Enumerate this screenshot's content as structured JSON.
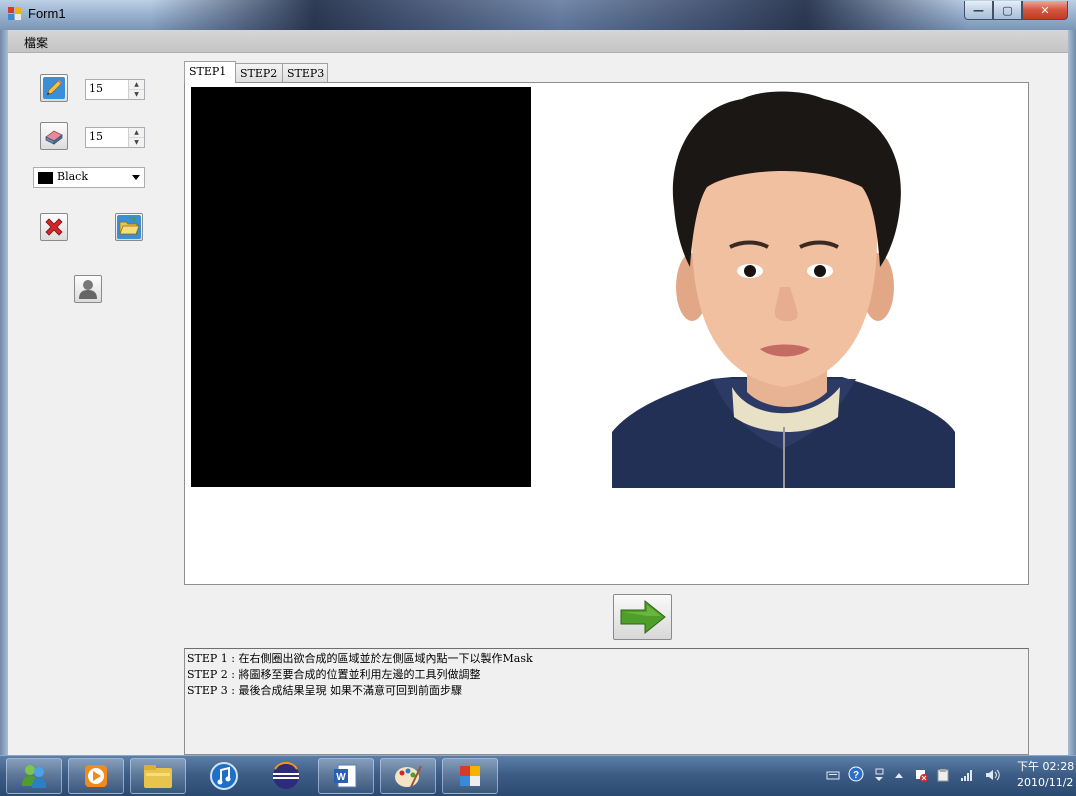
{
  "window": {
    "title": "Form1",
    "buttons": {
      "minimize": "—",
      "maximize": "▢",
      "close": "✕"
    }
  },
  "menu": {
    "file_label": "檔案"
  },
  "tools": {
    "pen_icon": "pencil-icon",
    "pen_size": "15",
    "eraser_icon": "eraser-icon",
    "eraser_size": "15",
    "color_select": {
      "selected": "Black",
      "swatch": "#000000"
    },
    "clear_icon": "red-x-icon",
    "open_icon": "open-folder-icon",
    "person_icon": "person-icon"
  },
  "tabs": [
    {
      "label": "STEP1",
      "active": true
    },
    {
      "label": "STEP2",
      "active": false
    },
    {
      "label": "STEP3",
      "active": false
    }
  ],
  "next_button_icon": "green-arrow-right-icon",
  "instructions": [
    "STEP 1 : 在右側圈出欲合成的區域並於左側區域內點一下以製作Mask",
    "STEP 2 : 將圖移至要合成的位置並利用左邊的工具列做調整",
    "STEP 3 : 最後合成結果呈現  如果不滿意可回到前面步驟"
  ],
  "taskbar": {
    "apps": [
      "windows-live-messenger-icon",
      "media-player-icon",
      "file-explorer-icon",
      "itunes-icon",
      "eclipse-icon",
      "word-icon",
      "paint-icon",
      "form-app-icon"
    ],
    "clock_time": "下午 02:28",
    "clock_date": "2010/11/2"
  },
  "colors": {
    "accent": "#3d5d86",
    "arrow_green": "#4f9e2a"
  }
}
